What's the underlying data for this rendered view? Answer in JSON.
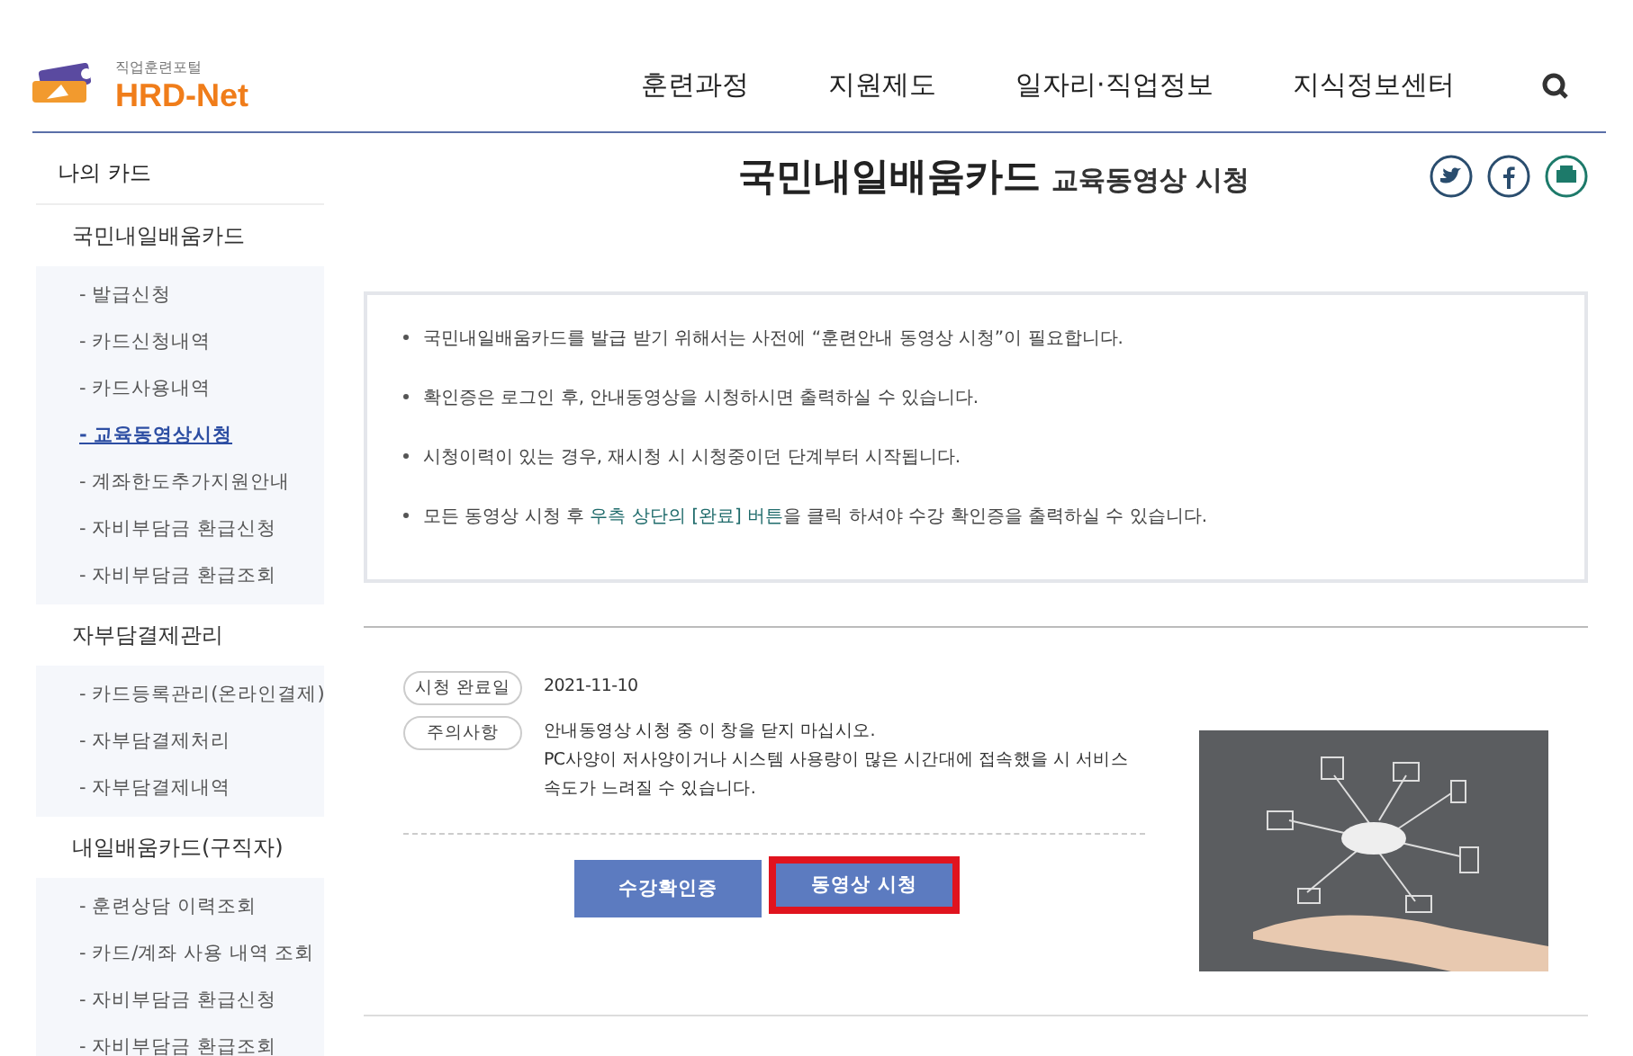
{
  "header": {
    "logo_tagline": "직업훈련포털",
    "logo_text": "HRD-Net",
    "nav": [
      {
        "label": "훈련과정"
      },
      {
        "label": "지원제도"
      },
      {
        "label": "일자리·직업정보"
      },
      {
        "label": "지식정보센터"
      }
    ]
  },
  "sidebar": {
    "title": "나의 카드",
    "groups": [
      {
        "title": "국민내일배움카드",
        "items": [
          {
            "label": "- 발급신청",
            "selected": false
          },
          {
            "label": "- 카드신청내역",
            "selected": false
          },
          {
            "label": "- 카드사용내역",
            "selected": false
          },
          {
            "label": "- 교육동영상시청",
            "selected": true
          },
          {
            "label": "- 계좌한도추가지원안내",
            "selected": false
          },
          {
            "label": "- 자비부담금 환급신청",
            "selected": false
          },
          {
            "label": "- 자비부담금 환급조회",
            "selected": false
          }
        ]
      },
      {
        "title": "자부담결제관리",
        "items": [
          {
            "label": "- 카드등록관리(온라인결제)",
            "selected": false
          },
          {
            "label": "- 자부담결제처리",
            "selected": false
          },
          {
            "label": "- 자부담결제내역",
            "selected": false
          }
        ]
      },
      {
        "title": "내일배움카드(구직자)",
        "items": [
          {
            "label": "- 훈련상담 이력조회",
            "selected": false
          },
          {
            "label": "- 카드/계좌 사용 내역 조회",
            "selected": false
          },
          {
            "label": "- 자비부담금 환급신청",
            "selected": false
          },
          {
            "label": "- 자비부담금 환급조회",
            "selected": false
          }
        ]
      }
    ]
  },
  "page": {
    "title": "국민내일배움카드",
    "subtitle": "교육동영상 시청"
  },
  "notices": [
    {
      "text": "국민내일배움카드를 발급 받기 위해서는 사전에 “훈련안내 동영상 시청”이 필요합니다."
    },
    {
      "text": "확인증은 로그인 후, 안내동영상을 시청하시면 출력하실 수 있습니다."
    },
    {
      "text": "시청이력이 있는 경우, 재시청 시 시청중이던 단계부터 시작됩니다."
    },
    {
      "text": "모든 동영상 시청 후 ",
      "highlight": "우측 상단의 [완료] 버튼",
      "after": "을 클릭 하셔야 수강 확인증을 출력하실 수 있습니다."
    }
  ],
  "info": [
    {
      "label": "시청 완료일",
      "lines": [
        "2021-11-10"
      ]
    },
    {
      "label": "주의사항",
      "lines": [
        "안내동영상 시청 중 이 창을 닫지 마십시오.",
        "PC사양이 저사양이거나 시스템 사용량이 많은 시간대에 접속했을 시 서비스 속도가 느려질 수 있습니다."
      ]
    }
  ],
  "buttons": [
    {
      "label": "수강확인증",
      "highlighted": false
    },
    {
      "label": "동영상 시청",
      "highlighted": true
    }
  ]
}
